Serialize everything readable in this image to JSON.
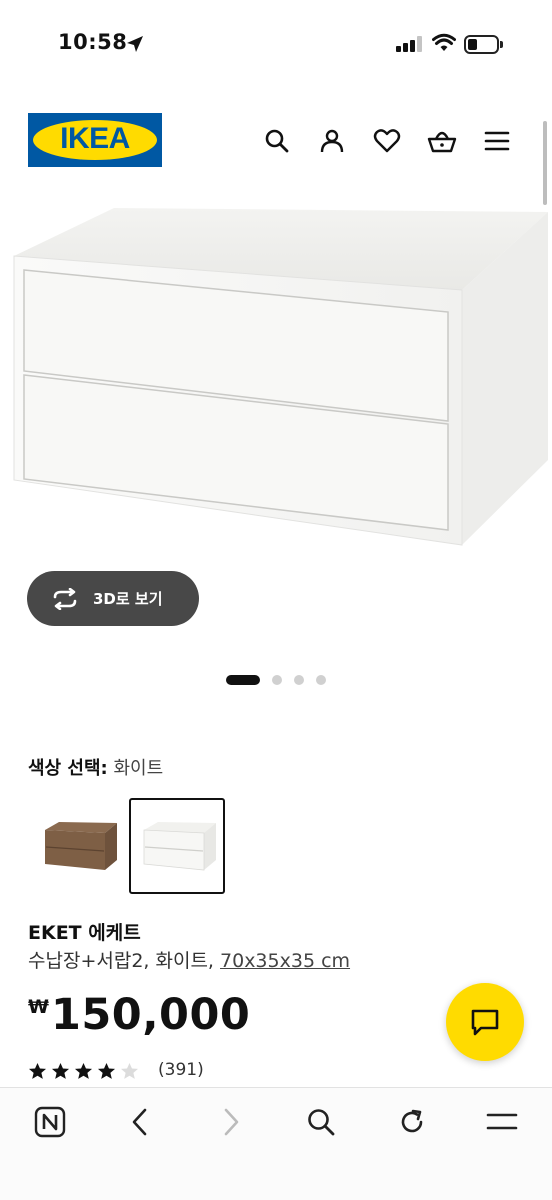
{
  "status_bar": {
    "time": "10:58"
  },
  "header": {
    "logo_text": "IKEA",
    "brand_blue": "#0058a3",
    "brand_yellow": "#ffdb00"
  },
  "gallery": {
    "view_3d_label": "3D로 보기",
    "pages": 4,
    "current_page": 1
  },
  "color_select": {
    "label": "색상 선택:",
    "value": "화이트",
    "options": [
      "월넛",
      "화이트"
    ],
    "selected": "화이트"
  },
  "product": {
    "name": "EKET 에케트",
    "description": "수납장+서랍2, 화이트,",
    "dimensions": "70x35x35 cm",
    "currency": "₩",
    "price": "150,000",
    "rating": 4,
    "rating_max": 5,
    "reviews": "(391)"
  },
  "icons": {
    "header": [
      "search-icon",
      "user-icon",
      "heart-icon",
      "basket-icon",
      "menu-icon"
    ],
    "bottom": [
      "naver-icon",
      "back-icon",
      "forward-icon",
      "search-icon",
      "reload-icon",
      "menu-icon"
    ]
  }
}
